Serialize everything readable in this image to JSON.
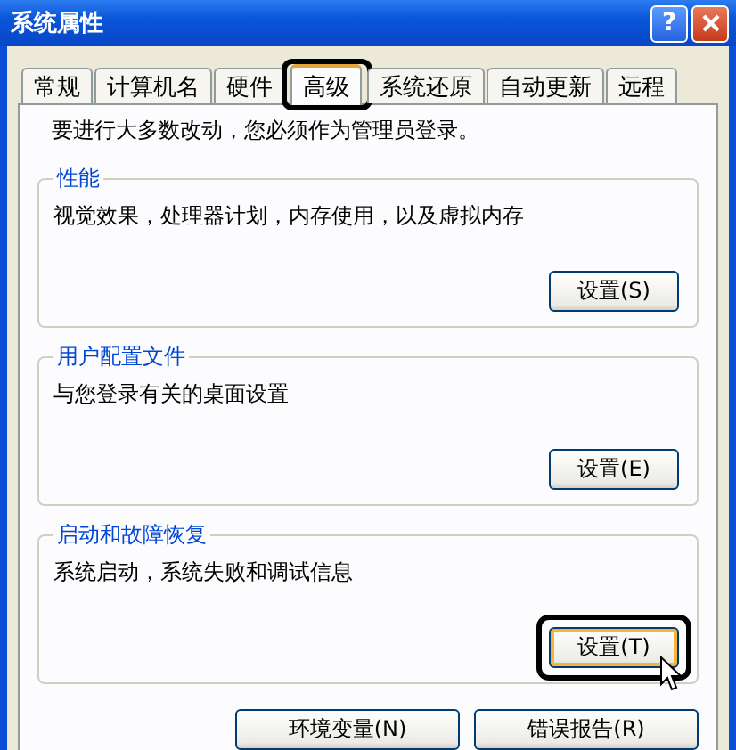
{
  "window": {
    "title": "系统属性",
    "controls": [
      {
        "kind": "help",
        "label": "?"
      },
      {
        "kind": "close"
      }
    ]
  },
  "tabs": [
    {
      "label": "常规",
      "selected": false,
      "highlighted": false
    },
    {
      "label": "计算机名",
      "selected": false,
      "highlighted": false
    },
    {
      "label": "硬件",
      "selected": false,
      "highlighted": false
    },
    {
      "label": "高级",
      "selected": true,
      "highlighted": true
    },
    {
      "label": "系统还原",
      "selected": false,
      "highlighted": false
    },
    {
      "label": "自动更新",
      "selected": false,
      "highlighted": false
    },
    {
      "label": "远程",
      "selected": false,
      "highlighted": false
    }
  ],
  "notice": "要进行大多数改动，您必须作为管理员登录。",
  "groups": [
    {
      "title": "性能",
      "description": "视觉效果，处理器计划，内存使用，以及虚拟内存",
      "button": {
        "label": "设置(S)",
        "highlighted": false,
        "hovered": false
      }
    },
    {
      "title": "用户配置文件",
      "description": "与您登录有关的桌面设置",
      "button": {
        "label": "设置(E)",
        "highlighted": false,
        "hovered": false
      }
    },
    {
      "title": "启动和故障恢复",
      "description": "系统启动，系统失败和调试信息",
      "button": {
        "label": "设置(T)",
        "highlighted": true,
        "hovered": true
      }
    }
  ],
  "bottom_buttons": [
    {
      "label": "环境变量(N)"
    },
    {
      "label": "错误报告(R)"
    }
  ]
}
